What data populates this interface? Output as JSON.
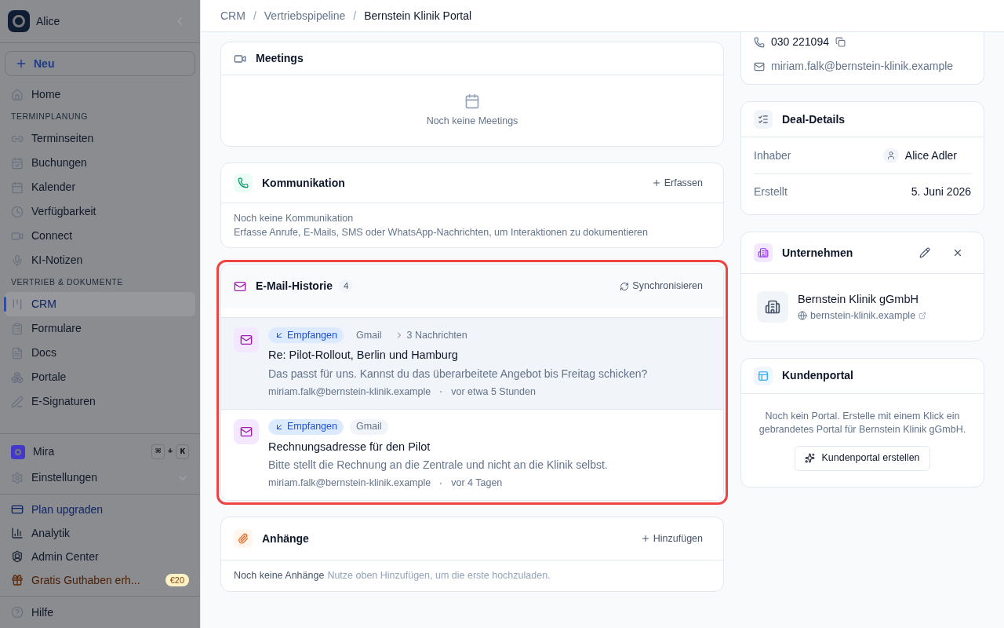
{
  "sidebar": {
    "workspace": "Alice",
    "new_button": "Neu",
    "dimmed": true,
    "items": [
      {
        "kind": "item",
        "label": "Home",
        "selected": false
      },
      {
        "kind": "section",
        "label": "TERMINPLANUNG"
      },
      {
        "kind": "item",
        "label": "Terminseiten",
        "selected": false
      },
      {
        "kind": "item",
        "label": "Buchungen",
        "selected": false
      },
      {
        "kind": "item",
        "label": "Kalender",
        "selected": false
      },
      {
        "kind": "item",
        "label": "Verfügbarkeit",
        "selected": false
      },
      {
        "kind": "item",
        "label": "Connect",
        "selected": false
      },
      {
        "kind": "item",
        "label": "KI-Notizen",
        "selected": false
      },
      {
        "kind": "section",
        "label": "VERTRIEB & DOKUMENTE"
      },
      {
        "kind": "item",
        "label": "CRM",
        "selected": true
      },
      {
        "kind": "item",
        "label": "Formulare",
        "selected": false
      },
      {
        "kind": "item",
        "label": "Docs",
        "selected": false
      },
      {
        "kind": "item",
        "label": "Portale",
        "selected": false
      },
      {
        "kind": "item",
        "label": "E-Signaturen",
        "selected": false
      }
    ],
    "assistant": {
      "label": "Mira",
      "keys": [
        "⌘",
        "+",
        "K"
      ]
    },
    "settings": {
      "label": "Einstellungen"
    },
    "bottom_items": [
      {
        "kind": "upgrade",
        "label": "Plan upgraden"
      },
      {
        "kind": "item",
        "label": "Analytik"
      },
      {
        "kind": "item",
        "label": "Admin Center"
      },
      {
        "kind": "promo",
        "label": "Gratis Guthaben erh...",
        "badge": "€20"
      }
    ],
    "help": "Hilfe"
  },
  "breadcrumb": [
    {
      "label": "CRM",
      "current": false
    },
    {
      "separator": "/",
      "label": "Vertriebspipeline",
      "current": false
    },
    {
      "separator": "/",
      "label": "Bernstein Klinik Portal",
      "current": true
    }
  ],
  "meetings": {
    "title": "Meetings",
    "empty": "Noch keine Meetings"
  },
  "communication": {
    "title": "Kommunikation",
    "action": "Erfassen",
    "empty_title": "Noch keine Kommunikation",
    "empty_text": "Erfasse Anrufe, E-Mails, SMS oder WhatsApp-Nachrichten, um Interaktionen zu dokumentieren"
  },
  "email_history": {
    "title": "E-Mail-Historie",
    "count": "4",
    "highlighted": true,
    "action": "Synchronisieren",
    "emails": [
      {
        "direction": "Empfangen",
        "source": "Gmail",
        "thread": "3 Nachrichten",
        "subject": "Re: Pilot-Rollout, Berlin und Hamburg",
        "preview": "Das passt für uns. Kannst du das überarbeitete Angebot bis Freitag schicken?",
        "sender": "miriam.falk@bernstein-klinik.example",
        "time": "vor etwa 5 Stunden",
        "hovered": true
      },
      {
        "direction": "Empfangen",
        "source": "Gmail",
        "subject": "Rechnungsadresse für den Pilot",
        "preview": "Bitte stellt die Rechnung an die Zentrale und nicht an die Klinik selbst.",
        "sender": "miriam.falk@bernstein-klinik.example",
        "time": "vor 4 Tagen",
        "hovered": false
      }
    ]
  },
  "attachments": {
    "title": "Anhänge",
    "action": "Hinzufügen",
    "empty_title": "Noch keine Anhänge",
    "empty_text": "Nutze oben Hinzufügen, um die erste hochzuladen."
  },
  "contact": {
    "phone": "030 221094",
    "email": "miriam.falk@bernstein-klinik.example"
  },
  "deal_details": {
    "title": "Deal-Details",
    "rows": [
      {
        "kind": "person",
        "label": "Inhaber",
        "value": "Alice Adler"
      },
      {
        "kind": "text",
        "label": "Erstellt",
        "value": "5. Juni 2026"
      }
    ]
  },
  "company": {
    "title": "Unternehmen",
    "name": "Bernstein Klinik gGmbH",
    "website": "bernstein-klinik.example"
  },
  "customer_portal": {
    "title": "Kundenportal",
    "text": "Noch kein Portal. Erstelle mit einem Klick ein gebrandetes Portal für Bernstein Klinik gGmbH.",
    "button": "Kundenportal erstellen"
  }
}
